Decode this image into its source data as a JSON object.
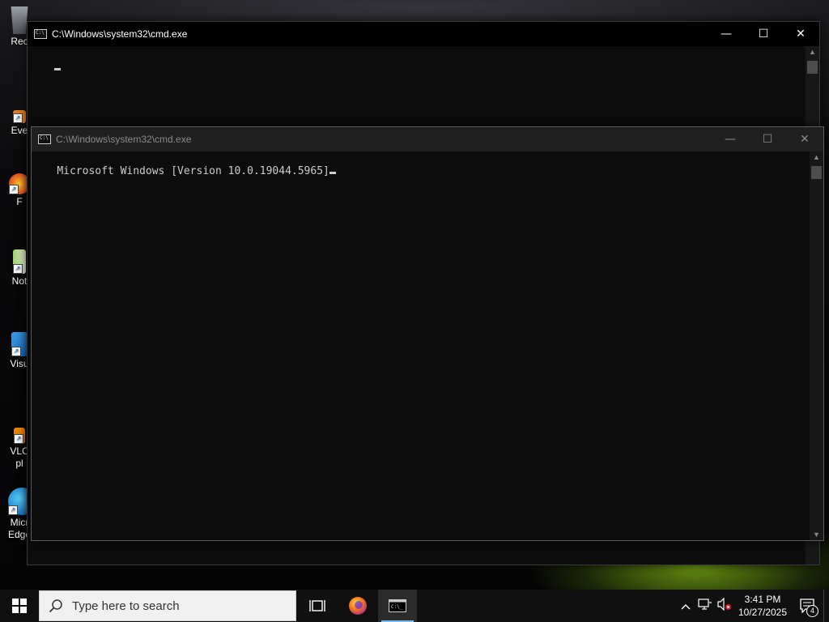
{
  "desktop": {
    "icons": [
      {
        "label": "Rec",
        "name": "recycle-bin"
      },
      {
        "label": "Eve",
        "name": "everything"
      },
      {
        "label": "F",
        "name": "firefox"
      },
      {
        "label": "Not",
        "name": "notepad"
      },
      {
        "label": "Visu",
        "name": "visual-studio-code"
      },
      {
        "label": "VLC",
        "label2": "pl",
        "name": "vlc-player"
      },
      {
        "label": "Micr",
        "label2": "Edge",
        "name": "microsoft-edge"
      }
    ]
  },
  "windows": {
    "back": {
      "title": "C:\\Windows\\system32\\cmd.exe",
      "content": ""
    },
    "front": {
      "title": "C:\\Windows\\system32\\cmd.exe",
      "content": "Microsoft Windows [Version 10.0.19044.5965]"
    },
    "controls": {
      "minimize": "—",
      "maximize": "☐",
      "close": "✕"
    }
  },
  "taskbar": {
    "search_placeholder": "Type here to search",
    "clock_time": "3:41 PM",
    "clock_date": "10/27/2025",
    "notification_count": "4",
    "tray_chevron": "^"
  },
  "colors": {
    "console_bg": "#0c0c0c",
    "console_text": "#cccccc",
    "taskbar_bg": "#101010",
    "accent": "#76b9ed"
  }
}
